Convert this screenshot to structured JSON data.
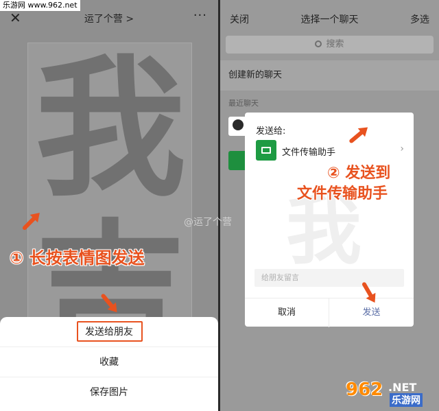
{
  "site_tag": "乐游网 www.962.net",
  "left": {
    "nav": {
      "title": "运了个营 >",
      "more": "···"
    },
    "sticker": {
      "chars": [
        "我",
        "吉"
      ]
    },
    "annotation": "① 长按表情图发送",
    "sheet": {
      "items": [
        "发送给朋友",
        "收藏",
        "保存图片"
      ]
    }
  },
  "right": {
    "nav": {
      "close": "关闭",
      "title": "选择一个聊天",
      "multi": "多选"
    },
    "search_placeholder": "搜索",
    "new_chat": "创建新的聊天",
    "recent_label": "最近聊天",
    "dialog": {
      "title": "发送给:",
      "target": "文件传输助手",
      "preview_char": "我",
      "message_placeholder": "给朋友留言",
      "cancel": "取消",
      "send": "发送"
    },
    "annotation_line1": "② 发送到",
    "annotation_line2": "文件传输助手"
  },
  "watermark": "@运了个营",
  "logo": {
    "num": "962",
    "net": ".NET",
    "cn": "乐游网"
  },
  "colors": {
    "accent": "#e8521f",
    "wechat_green": "#1e9b43"
  }
}
